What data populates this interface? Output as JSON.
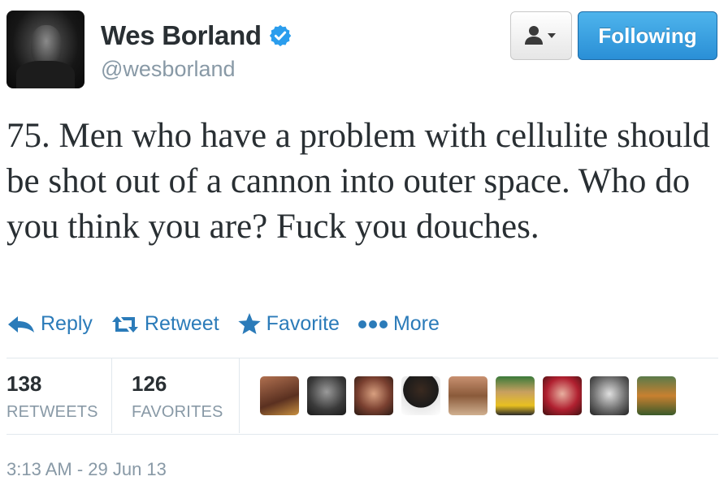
{
  "user": {
    "display_name": "Wes Borland",
    "handle": "@wesborland",
    "avatar_icon": "user-avatar"
  },
  "buttons": {
    "profile_menu_icon": "person-dropdown-icon",
    "follow_label": "Following"
  },
  "tweet": {
    "text": "75. Men who have a problem with cellulite should be shot out of a cannon into outer space. Who do you think you are? Fuck you douches."
  },
  "actions": {
    "reply": "Reply",
    "retweet": "Retweet",
    "favorite": "Favorite",
    "more": "More"
  },
  "stats": {
    "retweets_count": "138",
    "retweets_label": "RETWEETS",
    "favorites_count": "126",
    "favorites_label": "FAVORITES"
  },
  "faces": [
    "face-1",
    "face-2",
    "face-3",
    "face-4",
    "face-5",
    "face-6",
    "face-7",
    "face-8",
    "face-9"
  ],
  "timestamp": "3:13 AM - 29 Jun 13",
  "colors": {
    "accent": "#2b7bb9",
    "follow_button": "#3a9fe0",
    "muted": "#8899a6",
    "text": "#292f33"
  }
}
